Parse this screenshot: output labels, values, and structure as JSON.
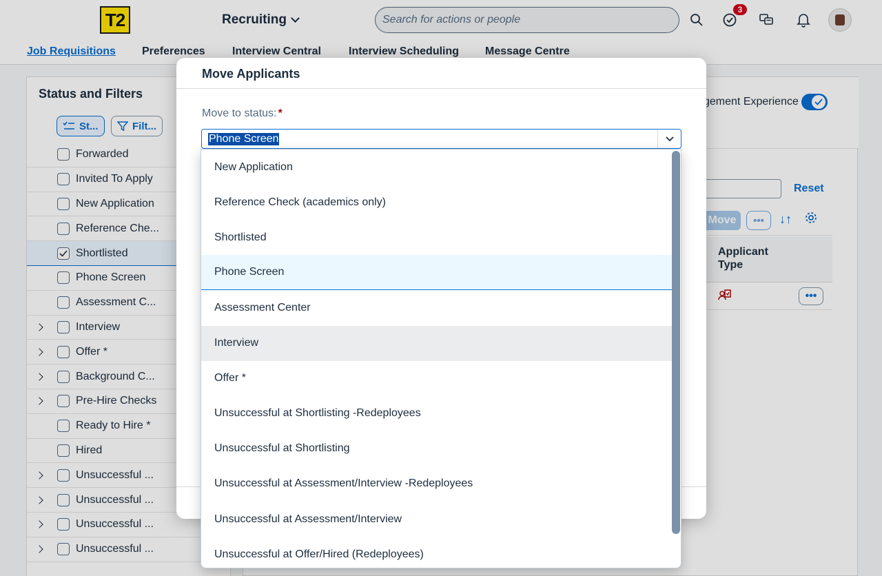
{
  "header": {
    "logo_text": "T2",
    "module": "Recruiting",
    "search_placeholder": "Search for actions or people",
    "notification_count": "3"
  },
  "tabs": [
    {
      "label": "Job Requisitions",
      "active": true
    },
    {
      "label": "Preferences"
    },
    {
      "label": "Interview Central"
    },
    {
      "label": "Interview Scheduling"
    },
    {
      "label": "Message Centre"
    }
  ],
  "left_panel": {
    "title": "Status and Filters",
    "status_button": "St...",
    "filter_button": "Filt...",
    "items": [
      {
        "label": "Forwarded",
        "checked": false,
        "expandable": false
      },
      {
        "label": "Invited To Apply",
        "checked": false,
        "expandable": false
      },
      {
        "label": "New Application",
        "checked": false,
        "expandable": false
      },
      {
        "label": "Reference Che...",
        "checked": false,
        "expandable": false
      },
      {
        "label": "Shortlisted",
        "checked": true,
        "expandable": false
      },
      {
        "label": "Phone Screen",
        "checked": false,
        "expandable": false
      },
      {
        "label": "Assessment C...",
        "checked": false,
        "expandable": false
      },
      {
        "label": "Interview",
        "checked": false,
        "expandable": true
      },
      {
        "label": "Offer *",
        "checked": false,
        "expandable": true
      },
      {
        "label": "Background C...",
        "checked": false,
        "expandable": true
      },
      {
        "label": "Pre-Hire Checks",
        "checked": false,
        "expandable": true
      },
      {
        "label": "Ready to Hire *",
        "checked": false,
        "expandable": false
      },
      {
        "label": "Hired",
        "checked": false,
        "expandable": false
      },
      {
        "label": "Unsuccessful ...",
        "checked": false,
        "expandable": true
      },
      {
        "label": "Unsuccessful ...",
        "checked": false,
        "expandable": true
      },
      {
        "label": "Unsuccessful ...",
        "checked": false,
        "expandable": true
      },
      {
        "label": "Unsuccessful ...",
        "checked": false,
        "expandable": true
      }
    ]
  },
  "right_panel": {
    "experience_label": "gement Experience",
    "reset_label": "Reset",
    "move_label": "Move",
    "column_applicant_type": "Applicant Type"
  },
  "dialog": {
    "title": "Move Applicants",
    "field_label": "Move to status:",
    "required_mark": "*",
    "selected_value": "Phone Screen",
    "options": [
      "New Application",
      "Reference Check (academics only)",
      "Shortlisted",
      "Phone Screen",
      "Assessment Center",
      "Interview",
      "Offer *",
      "Unsuccessful at Shortlisting -Redeployees",
      "Unsuccessful at Shortlisting",
      "Unsuccessful at Assessment/Interview -Redeployees",
      "Unsuccessful at Assessment/Interview",
      "Unsuccessful at Offer/Hired (Redeployees)"
    ],
    "selected_index": 3,
    "hover_index": 5
  },
  "colors": {
    "accent": "#0a6ed1",
    "logo_yellow": "#ffe500",
    "badge_red": "#d0021b"
  }
}
